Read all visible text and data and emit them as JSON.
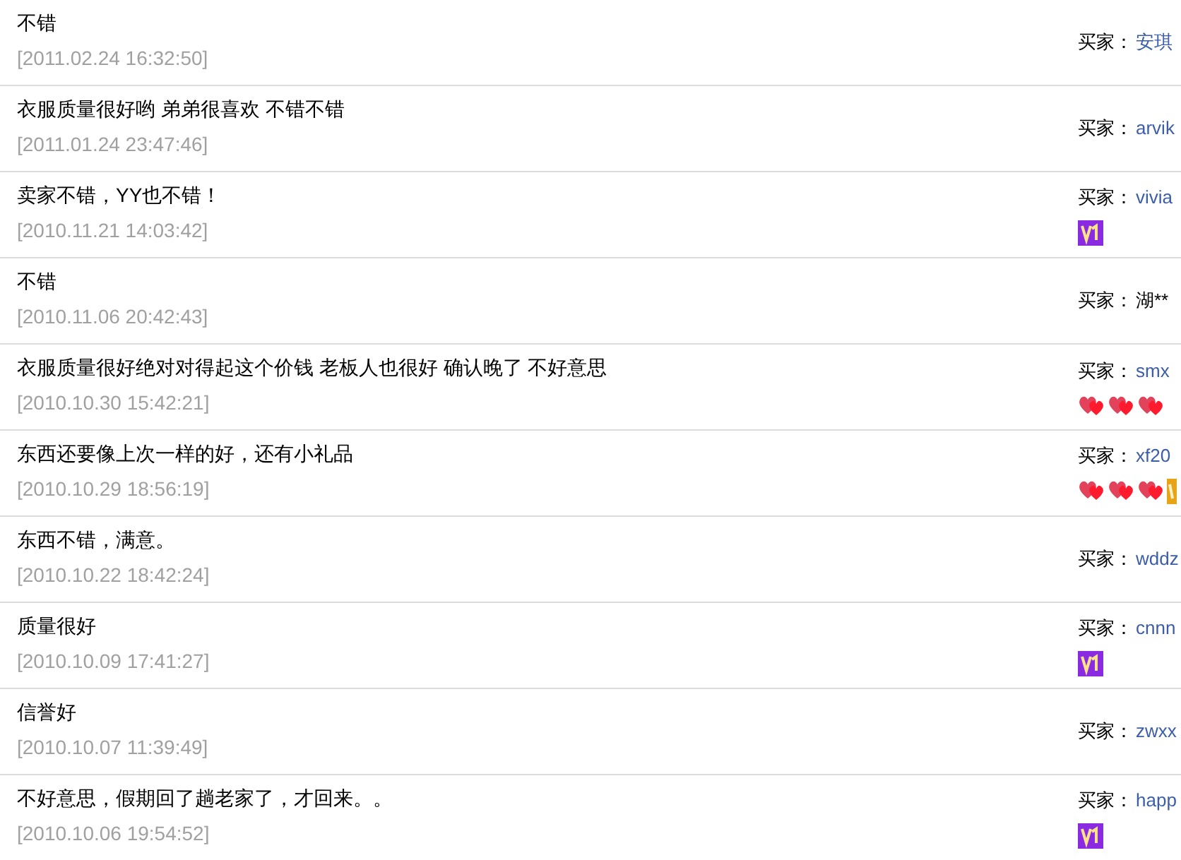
{
  "reviews": [
    {
      "comment": "不错",
      "date": "[2011.02.24 16:32:50]",
      "buyer_label": "买家：",
      "buyer": "安琪",
      "buyer_link": true
    },
    {
      "comment": "衣服质量很好哟 弟弟很喜欢 不错不错",
      "date": "[2011.01.24 23:47:46]",
      "buyer_label": "买家：",
      "buyer": "arvik",
      "buyer_link": true
    },
    {
      "comment": "卖家不错，YY也不错！",
      "date": "[2010.11.21 14:03:42]",
      "buyer_label": "买家：",
      "buyer": "vivia",
      "buyer_link": true,
      "badges": [
        {
          "kind": "vip"
        }
      ]
    },
    {
      "comment": "不错",
      "date": "[2010.11.06 20:42:43]",
      "buyer_label": "买家：",
      "buyer": "湖**",
      "buyer_link": false
    },
    {
      "comment": "衣服质量很好绝对对得起这个价钱 老板人也很好 确认晚了 不好意思",
      "date": "[2010.10.30 15:42:21]",
      "buyer_label": "买家：",
      "buyer": "smx",
      "buyer_link": true,
      "badges": [
        {
          "kind": "heart"
        },
        {
          "kind": "heart"
        },
        {
          "kind": "heart"
        }
      ]
    },
    {
      "comment": "东西还要像上次一样的好，还有小礼品",
      "date": "[2010.10.29 18:56:19]",
      "buyer_label": "买家：",
      "buyer": "xf20",
      "buyer_link": true,
      "badges": [
        {
          "kind": "heart"
        },
        {
          "kind": "heart"
        },
        {
          "kind": "heart"
        },
        {
          "kind": "gold"
        }
      ]
    },
    {
      "comment": "东西不错，满意。",
      "date": "[2010.10.22 18:42:24]",
      "buyer_label": "买家：",
      "buyer": "wddz",
      "buyer_link": true
    },
    {
      "comment": "质量很好",
      "date": "[2010.10.09 17:41:27]",
      "buyer_label": "买家：",
      "buyer": "cnnn",
      "buyer_link": true,
      "badges": [
        {
          "kind": "vip"
        }
      ]
    },
    {
      "comment": "信誉好",
      "date": "[2010.10.07 11:39:49]",
      "buyer_label": "买家：",
      "buyer": "zwxx",
      "buyer_link": true
    },
    {
      "comment": "不好意思，假期回了趟老家了，才回来。。",
      "date": "[2010.10.06 19:54:52]",
      "buyer_label": "买家：",
      "buyer": "happ",
      "buyer_link": true,
      "badges": [
        {
          "kind": "vip"
        }
      ]
    }
  ]
}
